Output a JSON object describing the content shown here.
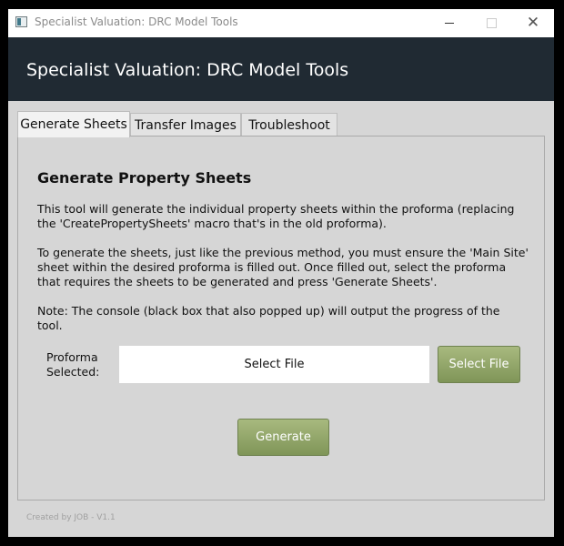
{
  "window": {
    "title": "Specialist Valuation: DRC Model Tools",
    "controls": {
      "minimize": "minimize",
      "maximize": "maximize",
      "close": "✕"
    }
  },
  "header": {
    "title": "Specialist Valuation: DRC Model Tools"
  },
  "tabs": [
    {
      "label": "Generate Sheets",
      "active": true
    },
    {
      "label": "Transfer Images",
      "active": false
    },
    {
      "label": "Troubleshoot",
      "active": false
    }
  ],
  "panel": {
    "title": "Generate Property Sheets",
    "paragraph1": "This tool will generate the individual property sheets within the proforma (replacing the 'CreatePropertySheets' macro that's in the old proforma).",
    "paragraph2": "To generate the sheets, just like the previous method, you must ensure the 'Main Site' sheet within the desired proforma is filled out. Once filled out, select the proforma that requires the sheets to be generated and press 'Generate Sheets'.",
    "paragraph3": "Note: The console (black box that also popped up) will output the progress of the tool.",
    "proforma_label": "Proforma Selected:",
    "file_display": "Select File",
    "select_button": "Select File",
    "generate_button": "Generate"
  },
  "footer": {
    "text": "Created by JOB - V1.1"
  },
  "colors": {
    "header_bg": "#202a33",
    "button_green": "#8ea266",
    "window_bg": "#d6d6d6"
  }
}
